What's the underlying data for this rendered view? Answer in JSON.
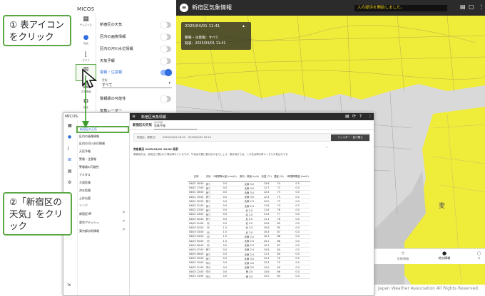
{
  "callouts": {
    "step1": "① 表アイコン\nをクリック",
    "step2": "②「新宿区の\n天気」をクリック"
  },
  "app": {
    "name": "MICOS",
    "name2": "MICOS"
  },
  "rail": [
    {
      "label": "サムネイル",
      "icon": "grid-icon"
    },
    {
      "label": "地点",
      "icon": "pin-icon"
    },
    {
      "label": "グラフ",
      "icon": "chart-icon"
    },
    {
      "label": "表",
      "icon": "table-icon"
    },
    {
      "label": "文書情報",
      "icon": "document-icon"
    },
    {
      "label": "設定",
      "icon": "gear-icon"
    }
  ],
  "layers": [
    {
      "label": "新宿区の天気",
      "on": false
    },
    {
      "label": "区内の画像情報",
      "on": false
    },
    {
      "label": "区内の河川水位情報",
      "on": false
    },
    {
      "label": "天気予報",
      "on": false
    },
    {
      "label": "警報・注意報",
      "on": true
    }
  ],
  "layer_select": {
    "label": "警報",
    "value": "すべて"
  },
  "layers_more": [
    {
      "label": "警報級の可能性"
    },
    {
      "label": "気象レーダー"
    }
  ],
  "map": {
    "title": "新宿区気象情報",
    "ticker": "入の提供を開始しました。",
    "info": {
      "time": "2025/04/01 11:41",
      "line1": "警報・注意報：すべて",
      "line2": "発表：2025/04/01 11:41"
    }
  },
  "bottom_tabs": [
    "気象情報",
    "地点情報",
    "カ"
  ],
  "footer": "Japan Weather Association All Rights Reserved.",
  "win": {
    "title": "新宿区気象情報",
    "tab_label": "新宿区の天気",
    "select_label": "表示内容",
    "select_value": "気象予報",
    "filter_row": "前回比：更新日：　　2025/04/02 16:23　2025/04/02 16:24",
    "filter_button": "フィルター・並び替え",
    "note_title": "気象概況 2025/04/02 16:00 発表",
    "note_text": "関東地方は、高気圧に覆われて概ね晴れていますが、午後は次第に雲が広がるでしょう。東京地方では、この先は晴れ時々くもりの見込みです。",
    "menu": [
      "新宿区の天気",
      "区内の画像情報",
      "区内の河川水位情報",
      "天気予報",
      "警報・注意報",
      "警報級の可能性",
      "アメダス",
      "大雨危険",
      "洪水危険",
      "土砂災害"
    ],
    "menu_link": "リンク",
    "links": [
      "新宿区HP",
      "東京アメッシュ",
      "東京都水防情報"
    ],
    "columns": [
      "日時",
      "天気",
      "1時間降水量\n(mm/h)",
      "風向・風速\n(m/s)",
      "気温\n(℃)",
      "湿度\n(%)",
      "1時間降雪量\n(cm/h)"
    ],
    "rows": [
      [
        "04/02 16:00",
        "曇り",
        "0.0",
        "北東 3.0",
        "13.6",
        "74",
        "0.0"
      ],
      [
        "04/02 17:00",
        "曇り",
        "0.0",
        "北東 3.0",
        "12.7",
        "72",
        "0.0"
      ],
      [
        "04/02 18:00",
        "曇り",
        "0.0",
        "北東 3.0",
        "12.4",
        "73",
        "0.0"
      ],
      [
        "04/02 19:00",
        "曇り",
        "0.0",
        "北東 3.0",
        "12.3",
        "73",
        "0.0"
      ],
      [
        "04/02 20:00",
        "曇り",
        "0.0",
        "北東 2.0",
        "12.0",
        "73",
        "0.0"
      ],
      [
        "04/02 21:00",
        "曇り",
        "0.0",
        "北東 2.0",
        "11.8",
        "74",
        "0.0"
      ],
      [
        "04/02 22:00",
        "曇り",
        "0.0",
        "北 2.0",
        "11.6",
        "76",
        "0.0"
      ],
      [
        "04/02 23:00",
        "曇り",
        "0.0",
        "北 2.0",
        "11.4",
        "77",
        "0.0"
      ],
      [
        "04/03 00:00",
        "曇り",
        "0.0",
        "北 2.0",
        "11.1",
        "78",
        "0.0"
      ],
      [
        "04/03 01:00",
        "雨",
        "0.5",
        "北 2.0",
        "10.8",
        "82",
        "0.0"
      ],
      [
        "04/03 02:00",
        "雨",
        "1.0",
        "北 2.0",
        "10.6",
        "85",
        "0.0"
      ],
      [
        "04/03 03:00",
        "雨",
        "1.5",
        "北 2.0",
        "10.4",
        "87",
        "0.0"
      ],
      [
        "04/03 04:00",
        "雨",
        "1.5",
        "北東 2.0",
        "10.3",
        "88",
        "0.0"
      ],
      [
        "04/03 05:00",
        "雨",
        "1.0",
        "北東 2.0",
        "10.2",
        "88",
        "0.0"
      ],
      [
        "04/03 06:00",
        "雨",
        "0.5",
        "北東 2.0",
        "10.3",
        "87",
        "0.0"
      ],
      [
        "04/03 07:00",
        "曇り",
        "0.0",
        "北東 2.0",
        "10.8",
        "84",
        "0.0"
      ],
      [
        "04/03 08:00",
        "曇り",
        "0.0",
        "北東 2.0",
        "11.5",
        "80",
        "0.0"
      ],
      [
        "04/03 09:00",
        "曇り",
        "0.0",
        "北東 3.0",
        "12.4",
        "76",
        "0.0"
      ],
      [
        "04/03 10:00",
        "晴れ",
        "0.0",
        "北東 3.0",
        "13.3",
        "72",
        "0.0"
      ],
      [
        "04/03 11:00",
        "晴れ",
        "0.0",
        "北東 3.0",
        "14.0",
        "69",
        "0.0"
      ],
      [
        "04/03 12:00",
        "晴れ",
        "0.0",
        "東 3.0",
        "14.6",
        "66",
        "0.0"
      ],
      [
        "04/03 13:00",
        "晴れ",
        "0.0",
        "東 3.0",
        "15.0",
        "64",
        "0.0"
      ]
    ]
  }
}
